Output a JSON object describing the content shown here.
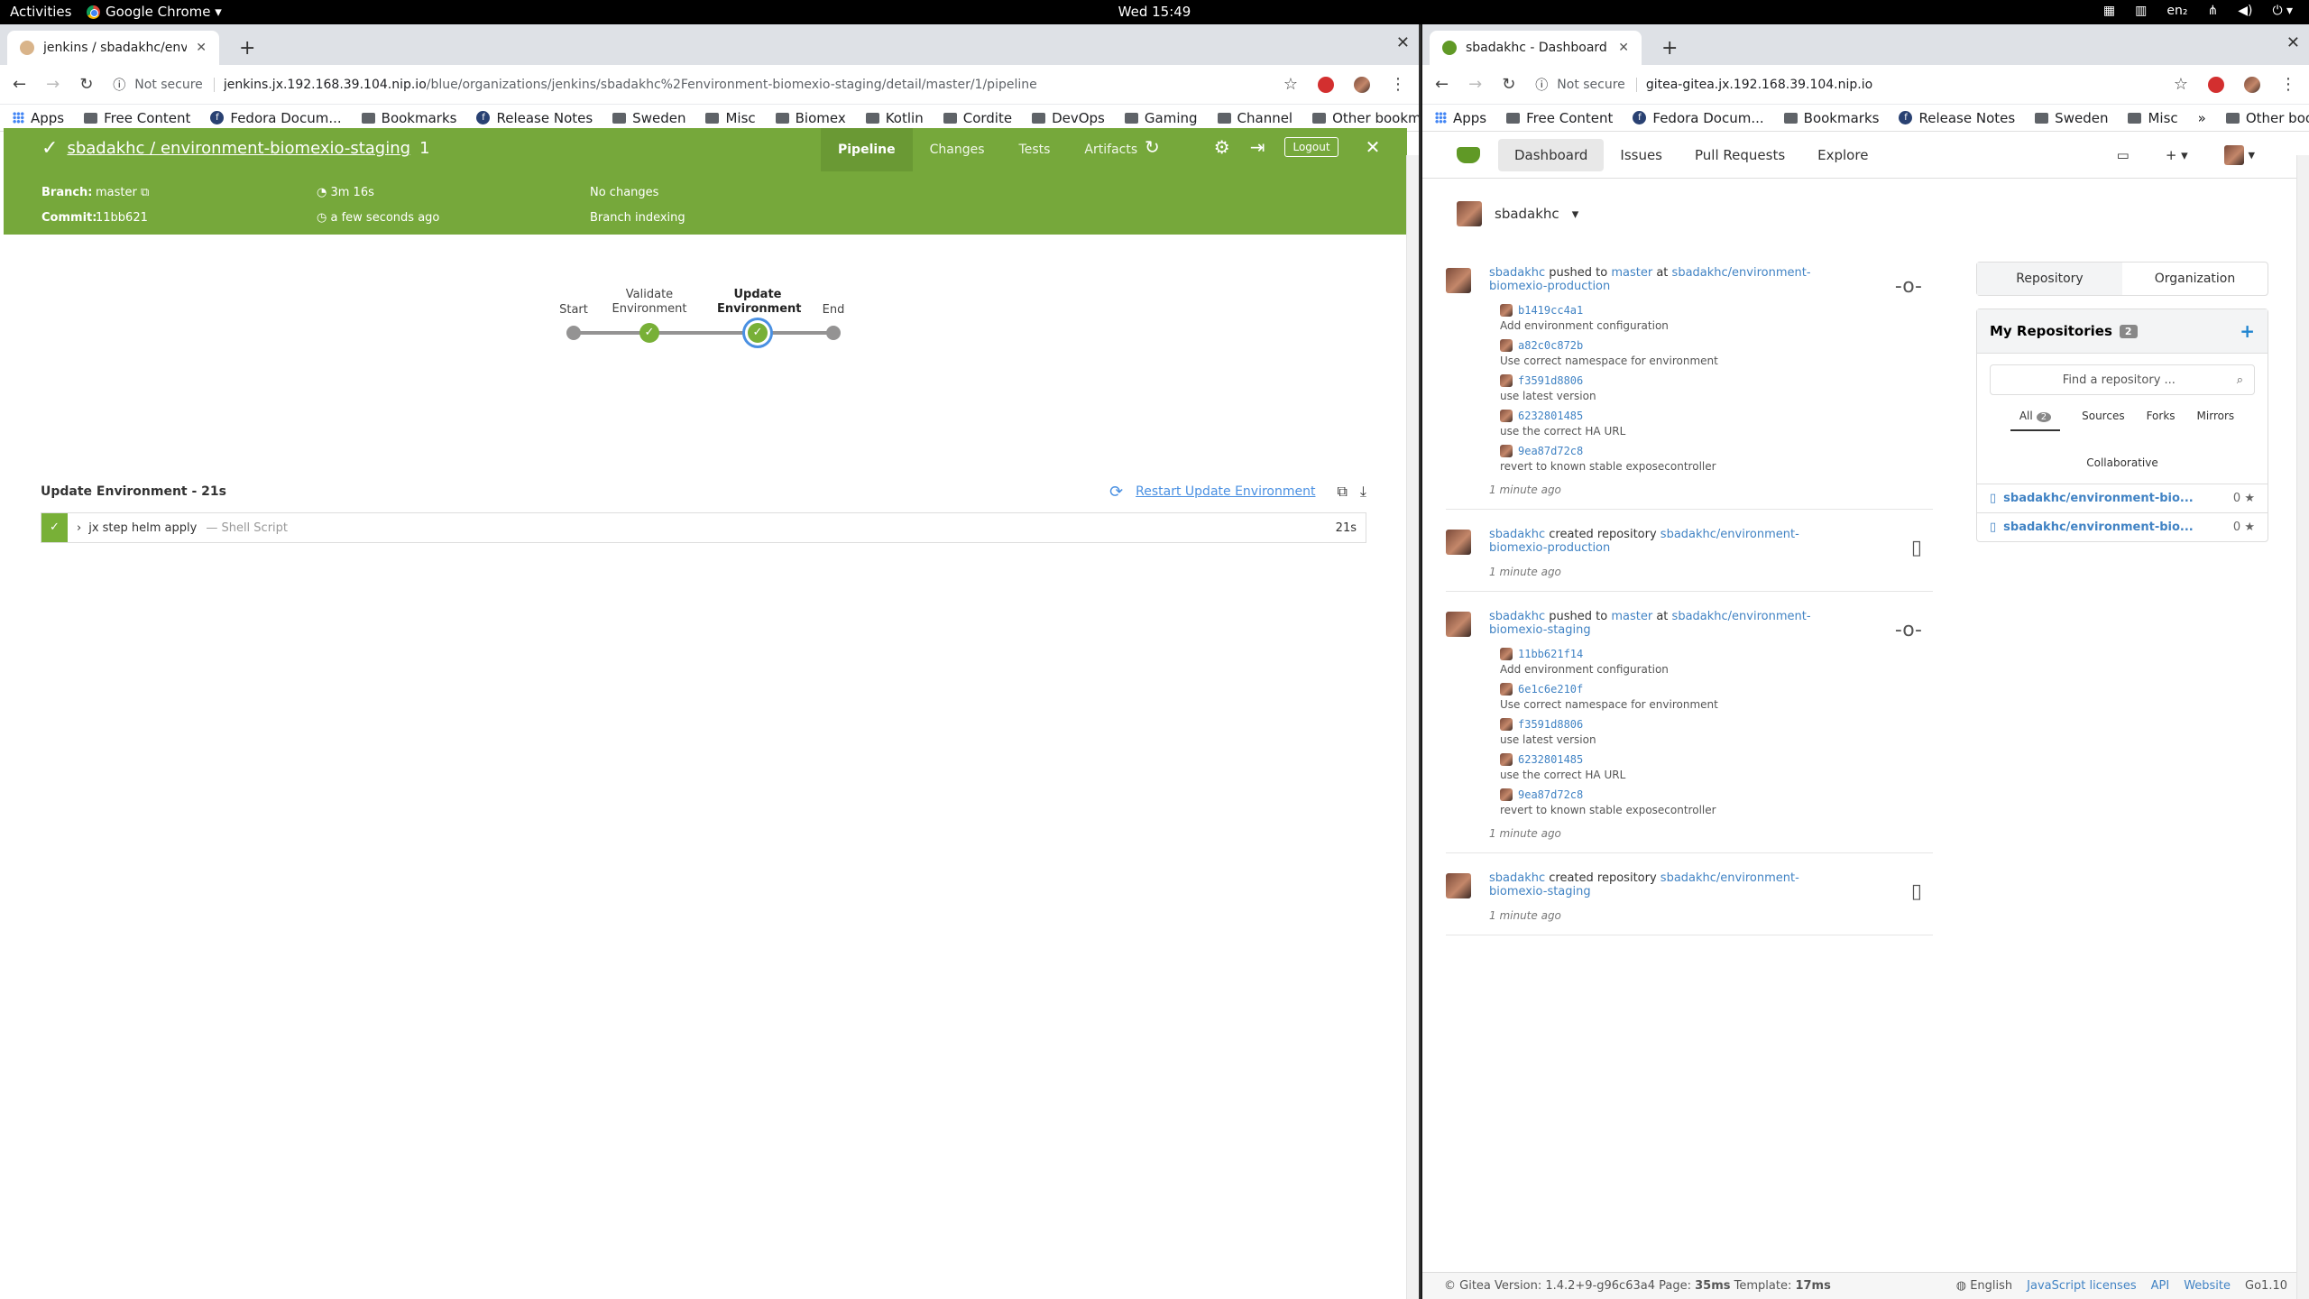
{
  "topbar": {
    "activities": "Activities",
    "app": "Google Chrome ▾",
    "clock": "Wed 15:49",
    "lang": "en₂"
  },
  "left": {
    "tab_title": "jenkins / sbadakhc/enviro",
    "not_secure": "Not secure",
    "url_host": "jenkins.jx.192.168.39.104.nip.io",
    "url_path": "/blue/organizations/jenkins/sbadakhc%2Fenvironment-biomexio-staging/detail/master/1/pipeline",
    "bookmarks": [
      "Apps",
      "Free Content",
      "Fedora Docum...",
      "Bookmarks",
      "Release Notes",
      "Sweden",
      "Misc",
      "Biomex",
      "Kotlin",
      "Cordite",
      "DevOps",
      "Gaming",
      "Channel"
    ],
    "other_bookmarks": "Other bookmarks",
    "jenkins": {
      "title": "sbadakhc / environment-biomexio-staging",
      "run": "1",
      "tabs": [
        "Pipeline",
        "Changes",
        "Tests",
        "Artifacts"
      ],
      "logout": "Logout",
      "branch_label": "Branch:",
      "branch": "master",
      "commit_label": "Commit:",
      "commit": "11bb621",
      "duration": "3m 16s",
      "ago": "a few seconds ago",
      "changes": "No changes",
      "cause": "Branch indexing",
      "stages": [
        "Start",
        "Validate Environment",
        "Update Environment",
        "End"
      ],
      "step_header": "Update Environment - 21s",
      "restart": "Restart Update Environment",
      "step_name": "jx step helm apply",
      "step_type": "— Shell Script",
      "step_time": "21s"
    }
  },
  "right": {
    "tab_title": "sbadakhc - Dashboard - G",
    "not_secure": "Not secure",
    "url_host": "gitea-gitea.jx.192.168.39.104.nip.io",
    "bookmarks": [
      "Apps",
      "Free Content",
      "Fedora Docum...",
      "Bookmarks",
      "Release Notes",
      "Sweden",
      "Misc"
    ],
    "more": "»",
    "other_bookmarks": "Other bookmarks",
    "nav": [
      "Dashboard",
      "Issues",
      "Pull Requests",
      "Explore"
    ],
    "context_user": "sbadakhc",
    "feed": [
      {
        "user": "sbadakhc",
        "action": "pushed to",
        "branch": "master",
        "at": "at",
        "repo": "sbadakhc/environment-biomexio-production",
        "commits": [
          {
            "sha": "b1419cc4a1",
            "msg": "Add environment configuration"
          },
          {
            "sha": "a82c0c872b",
            "msg": "Use correct namespace for environment"
          },
          {
            "sha": "f3591d8806",
            "msg": "use latest version"
          },
          {
            "sha": "6232801485",
            "msg": "use the correct HA URL"
          },
          {
            "sha": "9ea87d72c8",
            "msg": "revert to known stable exposecontroller"
          }
        ],
        "time": "1 minute ago"
      },
      {
        "user": "sbadakhc",
        "action": "created repository",
        "repo": "sbadakhc/environment-biomexio-production",
        "time": "1 minute ago"
      },
      {
        "user": "sbadakhc",
        "action": "pushed to",
        "branch": "master",
        "at": "at",
        "repo": "sbadakhc/environment-biomexio-staging",
        "commits": [
          {
            "sha": "11bb621f14",
            "msg": "Add environment configuration"
          },
          {
            "sha": "6e1c6e210f",
            "msg": "Use correct namespace for environment"
          },
          {
            "sha": "f3591d8806",
            "msg": "use latest version"
          },
          {
            "sha": "6232801485",
            "msg": "use the correct HA URL"
          },
          {
            "sha": "9ea87d72c8",
            "msg": "revert to known stable exposecontroller"
          }
        ],
        "time": "1 minute ago"
      },
      {
        "user": "sbadakhc",
        "action": "created repository",
        "repo": "sbadakhc/environment-biomexio-staging",
        "time": "1 minute ago"
      }
    ],
    "side": {
      "tabs": [
        "Repository",
        "Organization"
      ],
      "my_repos": "My Repositories",
      "repo_count": "2",
      "search_placeholder": "Find a repository ...",
      "filters": [
        "All",
        "Sources",
        "Forks",
        "Mirrors",
        "Collaborative"
      ],
      "all_count": "2",
      "repos": [
        {
          "name": "sbadakhc/environment-bio...",
          "stars": "0"
        },
        {
          "name": "sbadakhc/environment-bio...",
          "stars": "0"
        }
      ]
    },
    "footer": {
      "version": "© Gitea Version: 1.4.2+9-g96c63a4 Page:",
      "page_ms": "35ms",
      "template_label": "Template:",
      "template_ms": "17ms",
      "lang": "English",
      "links": [
        "JavaScript licenses",
        "API",
        "Website",
        "Go1.10"
      ]
    }
  },
  "colors": {
    "jenkins_green": "#76a83b",
    "success": "#78b037",
    "link": "#4183c4",
    "gitea": "#609926"
  }
}
